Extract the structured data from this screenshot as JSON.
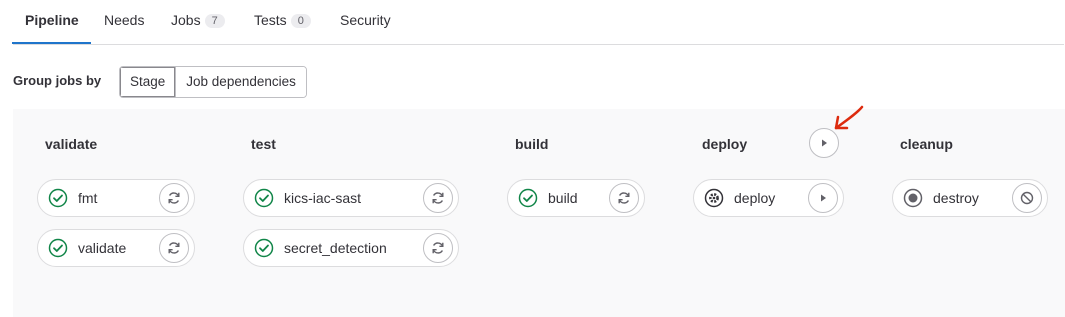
{
  "tabs": [
    {
      "label": "Pipeline"
    },
    {
      "label": "Needs"
    },
    {
      "label": "Jobs",
      "count": "7"
    },
    {
      "label": "Tests",
      "count": "0"
    },
    {
      "label": "Security"
    }
  ],
  "group_by": {
    "label": "Group jobs by",
    "options": [
      "Stage",
      "Job dependencies"
    ],
    "selected": "Stage"
  },
  "stages": [
    {
      "name": "validate",
      "jobs": [
        {
          "name": "fmt",
          "status": "passed",
          "action": "retry"
        },
        {
          "name": "validate",
          "status": "passed",
          "action": "retry"
        }
      ]
    },
    {
      "name": "test",
      "jobs": [
        {
          "name": "kics-iac-sast",
          "status": "passed",
          "action": "retry"
        },
        {
          "name": "secret_detection",
          "status": "passed",
          "action": "retry"
        }
      ]
    },
    {
      "name": "build",
      "jobs": [
        {
          "name": "build",
          "status": "passed",
          "action": "retry"
        }
      ]
    },
    {
      "name": "deploy",
      "stage_action": "play",
      "jobs": [
        {
          "name": "deploy",
          "status": "manual",
          "action": "play"
        }
      ]
    },
    {
      "name": "cleanup",
      "jobs": [
        {
          "name": "destroy",
          "status": "created",
          "action": "cancel"
        }
      ]
    }
  ],
  "colors": {
    "success": "#108548",
    "active_tab": "#1f75cb",
    "annotation_arrow": "#dd2b0e"
  }
}
